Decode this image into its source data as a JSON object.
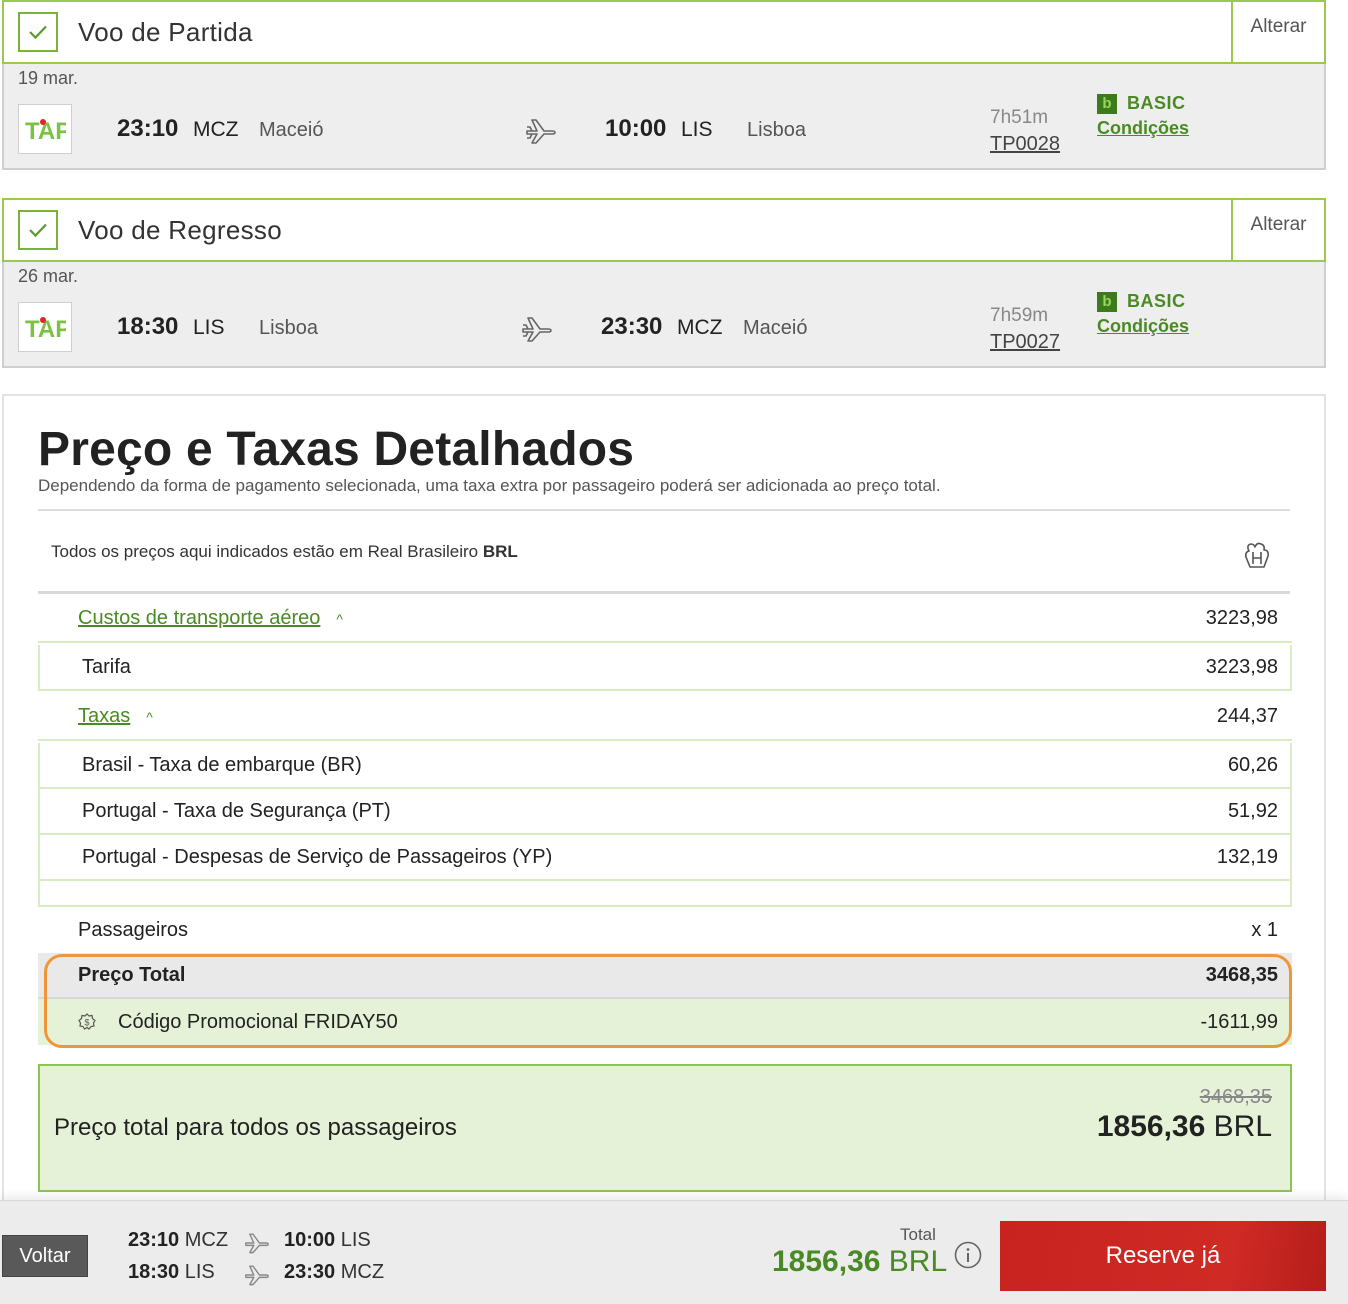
{
  "outbound": {
    "title": "Voo de Partida",
    "change": "Alterar",
    "date": "19 mar.",
    "dep_time": "23:10",
    "dep_code": "MCZ",
    "dep_city": "Maceió",
    "arr_time": "10:00",
    "arr_code": "LIS",
    "arr_city": "Lisboa",
    "duration": "7h51m",
    "flight_number": "TP0028",
    "fare": "BASIC",
    "conditions": "Condições"
  },
  "inbound": {
    "title": "Voo de Regresso",
    "change": "Alterar",
    "date": "26 mar.",
    "dep_time": "18:30",
    "dep_code": "LIS",
    "dep_city": "Lisboa",
    "arr_time": "23:30",
    "arr_code": "MCZ",
    "arr_city": "Maceió",
    "duration": "7h59m",
    "flight_number": "TP0027",
    "fare": "BASIC",
    "conditions": "Condições"
  },
  "fare_badge_letter": "b",
  "logo_text": "TAP",
  "price": {
    "title": "Preço e Taxas Detalhados",
    "subtitle": "Dependendo da forma de pagamento selecionada, uma taxa extra por passageiro poderá ser adicionada ao preço total.",
    "currency_note": "Todos os preços aqui indicados estão em Real Brasileiro",
    "currency_code": "BRL",
    "air_costs_label": "Custos de transporte aéreo",
    "air_costs_value": "3223,98",
    "tarifa_label": "Tarifa",
    "tarifa_value": "3223,98",
    "taxes_label": "Taxas",
    "taxes_value": "244,37",
    "tax_items": [
      {
        "label": "Brasil - Taxa de embarque (BR)",
        "value": "60,26"
      },
      {
        "label": "Portugal - Taxa de Segurança (PT)",
        "value": "51,92"
      },
      {
        "label": "Portugal - Despesas de Serviço de Passageiros (YP)",
        "value": "132,19"
      }
    ],
    "passengers_label": "Passageiros",
    "passengers_value": "x 1",
    "total_label": "Preço Total",
    "total_value": "3468,35",
    "promo_label": "Código Promocional FRIDAY50",
    "promo_value": "-1611,99",
    "grand_label": "Preço total para todos os passageiros",
    "grand_old": "3468,35",
    "grand_amount": "1856,36",
    "grand_currency": "BRL"
  },
  "bottom": {
    "back": "Voltar",
    "out_dep_time": "23:10",
    "out_dep_code": "MCZ",
    "out_arr_time": "10:00",
    "out_arr_code": "LIS",
    "in_dep_time": "18:30",
    "in_dep_code": "LIS",
    "in_arr_time": "23:30",
    "in_arr_code": "MCZ",
    "total_caption": "Total",
    "total_amount": "1856,36",
    "total_currency": "BRL",
    "reserve": "Reserve já"
  },
  "colors": {
    "green": "#4a8a25",
    "green_border": "#9bc94e",
    "highlight": "#f0963a",
    "reserve_red": "#c8231f"
  }
}
